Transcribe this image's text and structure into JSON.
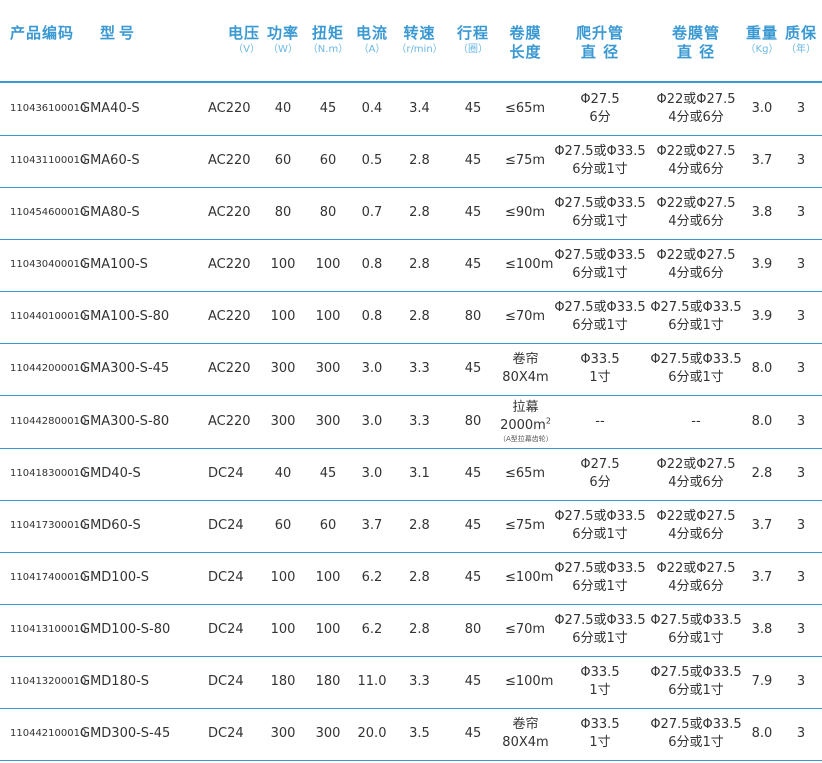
{
  "headers": {
    "code": "产品编码",
    "model": "型号",
    "voltage": "电压",
    "voltage_unit": "（V）",
    "power": "功率",
    "power_unit": "（W）",
    "torque": "扭矩",
    "torque_unit": "（N.m）",
    "current": "电流",
    "current_unit": "（A）",
    "speed": "转速",
    "speed_unit": "（r/min）",
    "stroke": "行程",
    "stroke_unit": "（圈）",
    "film_len_1": "卷膜",
    "film_len_2": "长度",
    "climb_1": "爬升管",
    "climb_2": "直 径",
    "film_pipe_1": "卷膜管",
    "film_pipe_2": "直 径",
    "weight": "重量",
    "weight_unit": "（Kg）",
    "warranty": "质保",
    "warranty_unit": "（年）"
  },
  "rows": [
    {
      "code": "110436100010",
      "model": "GMA40-S",
      "voltage": "AC220",
      "power": "40",
      "torque": "45",
      "current": "0.4",
      "speed": "3.4",
      "stroke": "45",
      "length": "≤65m",
      "length_sub": "",
      "climb_1": "Φ27.5",
      "climb_2": "6分",
      "pipe_1": "Φ22或Φ27.5",
      "pipe_2": "4分或6分",
      "weight": "3.0",
      "warranty": "3"
    },
    {
      "code": "110431100010",
      "model": "GMA60-S",
      "voltage": "AC220",
      "power": "60",
      "torque": "60",
      "current": "0.5",
      "speed": "2.8",
      "stroke": "45",
      "length": "≤75m",
      "length_sub": "",
      "climb_1": "Φ27.5或Φ33.5",
      "climb_2": "6分或1寸",
      "pipe_1": "Φ22或Φ27.5",
      "pipe_2": "4分或6分",
      "weight": "3.7",
      "warranty": "3"
    },
    {
      "code": "110454600010",
      "model": "GMA80-S",
      "voltage": "AC220",
      "power": "80",
      "torque": "80",
      "current": "0.7",
      "speed": "2.8",
      "stroke": "45",
      "length": "≤90m",
      "length_sub": "",
      "climb_1": "Φ27.5或Φ33.5",
      "climb_2": "6分或1寸",
      "pipe_1": "Φ22或Φ27.5",
      "pipe_2": "4分或6分",
      "weight": "3.8",
      "warranty": "3"
    },
    {
      "code": "110430400010",
      "model": "GMA100-S",
      "voltage": "AC220",
      "power": "100",
      "torque": "100",
      "current": "0.8",
      "speed": "2.8",
      "stroke": "45",
      "length": "≤100m",
      "length_sub": "",
      "climb_1": "Φ27.5或Φ33.5",
      "climb_2": "6分或1寸",
      "pipe_1": "Φ22或Φ27.5",
      "pipe_2": "4分或6分",
      "weight": "3.9",
      "warranty": "3"
    },
    {
      "code": "110440100010",
      "model": "GMA100-S-80",
      "voltage": "AC220",
      "power": "100",
      "torque": "100",
      "current": "0.8",
      "speed": "2.8",
      "stroke": "80",
      "length": "≤70m",
      "length_sub": "",
      "climb_1": "Φ27.5或Φ33.5",
      "climb_2": "6分或1寸",
      "pipe_1": "Φ27.5或Φ33.5",
      "pipe_2": "6分或1寸",
      "weight": "3.9",
      "warranty": "3"
    },
    {
      "code": "110442000010",
      "model": "GMA300-S-45",
      "voltage": "AC220",
      "power": "300",
      "torque": "300",
      "current": "3.0",
      "speed": "3.3",
      "stroke": "45",
      "length": "卷帘",
      "length2": "80X4m",
      "length_sub": "",
      "climb_1": "Φ33.5",
      "climb_2": "1寸",
      "pipe_1": "Φ27.5或Φ33.5",
      "pipe_2": "6分或1寸",
      "weight": "8.0",
      "warranty": "3"
    },
    {
      "code": "110442800010",
      "model": "GMA300-S-80",
      "voltage": "AC220",
      "power": "300",
      "torque": "300",
      "current": "3.0",
      "speed": "3.3",
      "stroke": "80",
      "length": "拉幕",
      "length2": "2000m",
      "length_sup": "2",
      "length_sub": "（A型拉幕齿轮）",
      "climb_1": "--",
      "climb_2": "",
      "pipe_1": "--",
      "pipe_2": "",
      "weight": "8.0",
      "warranty": "3"
    },
    {
      "code": "110418300010",
      "model": "GMD40-S",
      "voltage": "DC24",
      "power": "40",
      "torque": "45",
      "current": "3.0",
      "speed": "3.1",
      "stroke": "45",
      "length": "≤65m",
      "length_sub": "",
      "climb_1": "Φ27.5",
      "climb_2": "6分",
      "pipe_1": "Φ22或Φ27.5",
      "pipe_2": "4分或6分",
      "weight": "2.8",
      "warranty": "3"
    },
    {
      "code": "110417300010",
      "model": "GMD60-S",
      "voltage": "DC24",
      "power": "60",
      "torque": "60",
      "current": "3.7",
      "speed": "2.8",
      "stroke": "45",
      "length": "≤75m",
      "length_sub": "",
      "climb_1": "Φ27.5或Φ33.5",
      "climb_2": "6分或1寸",
      "pipe_1": "Φ22或Φ27.5",
      "pipe_2": "4分或6分",
      "weight": "3.7",
      "warranty": "3"
    },
    {
      "code": "110417400010",
      "model": "GMD100-S",
      "voltage": "DC24",
      "power": "100",
      "torque": "100",
      "current": "6.2",
      "speed": "2.8",
      "stroke": "45",
      "length": "≤100m",
      "length_sub": "",
      "climb_1": "Φ27.5或Φ33.5",
      "climb_2": "6分或1寸",
      "pipe_1": "Φ22或Φ27.5",
      "pipe_2": "4分或6分",
      "weight": "3.7",
      "warranty": "3"
    },
    {
      "code": "110413100010",
      "model": "GMD100-S-80",
      "voltage": "DC24",
      "power": "100",
      "torque": "100",
      "current": "6.2",
      "speed": "2.8",
      "stroke": "80",
      "length": "≤70m",
      "length_sub": "",
      "climb_1": "Φ27.5或Φ33.5",
      "climb_2": "6分或1寸",
      "pipe_1": "Φ27.5或Φ33.5",
      "pipe_2": "6分或1寸",
      "weight": "3.8",
      "warranty": "3"
    },
    {
      "code": "110413200010",
      "model": "GMD180-S",
      "voltage": "DC24",
      "power": "180",
      "torque": "180",
      "current": "11.0",
      "speed": "3.3",
      "stroke": "45",
      "length": "≤100m",
      "length_sub": "",
      "climb_1": "Φ33.5",
      "climb_2": "1寸",
      "pipe_1": "Φ27.5或Φ33.5",
      "pipe_2": "6分或1寸",
      "weight": "7.9",
      "warranty": "3"
    },
    {
      "code": "110442100010",
      "model": "GMD300-S-45",
      "voltage": "DC24",
      "power": "300",
      "torque": "300",
      "current": "20.0",
      "speed": "3.5",
      "stroke": "45",
      "length": "卷帘",
      "length2": "80X4m",
      "length_sub": "",
      "climb_1": "Φ33.5",
      "climb_2": "1寸",
      "pipe_1": "Φ27.5或Φ33.5",
      "pipe_2": "6分或1寸",
      "weight": "8.0",
      "warranty": "3"
    }
  ]
}
